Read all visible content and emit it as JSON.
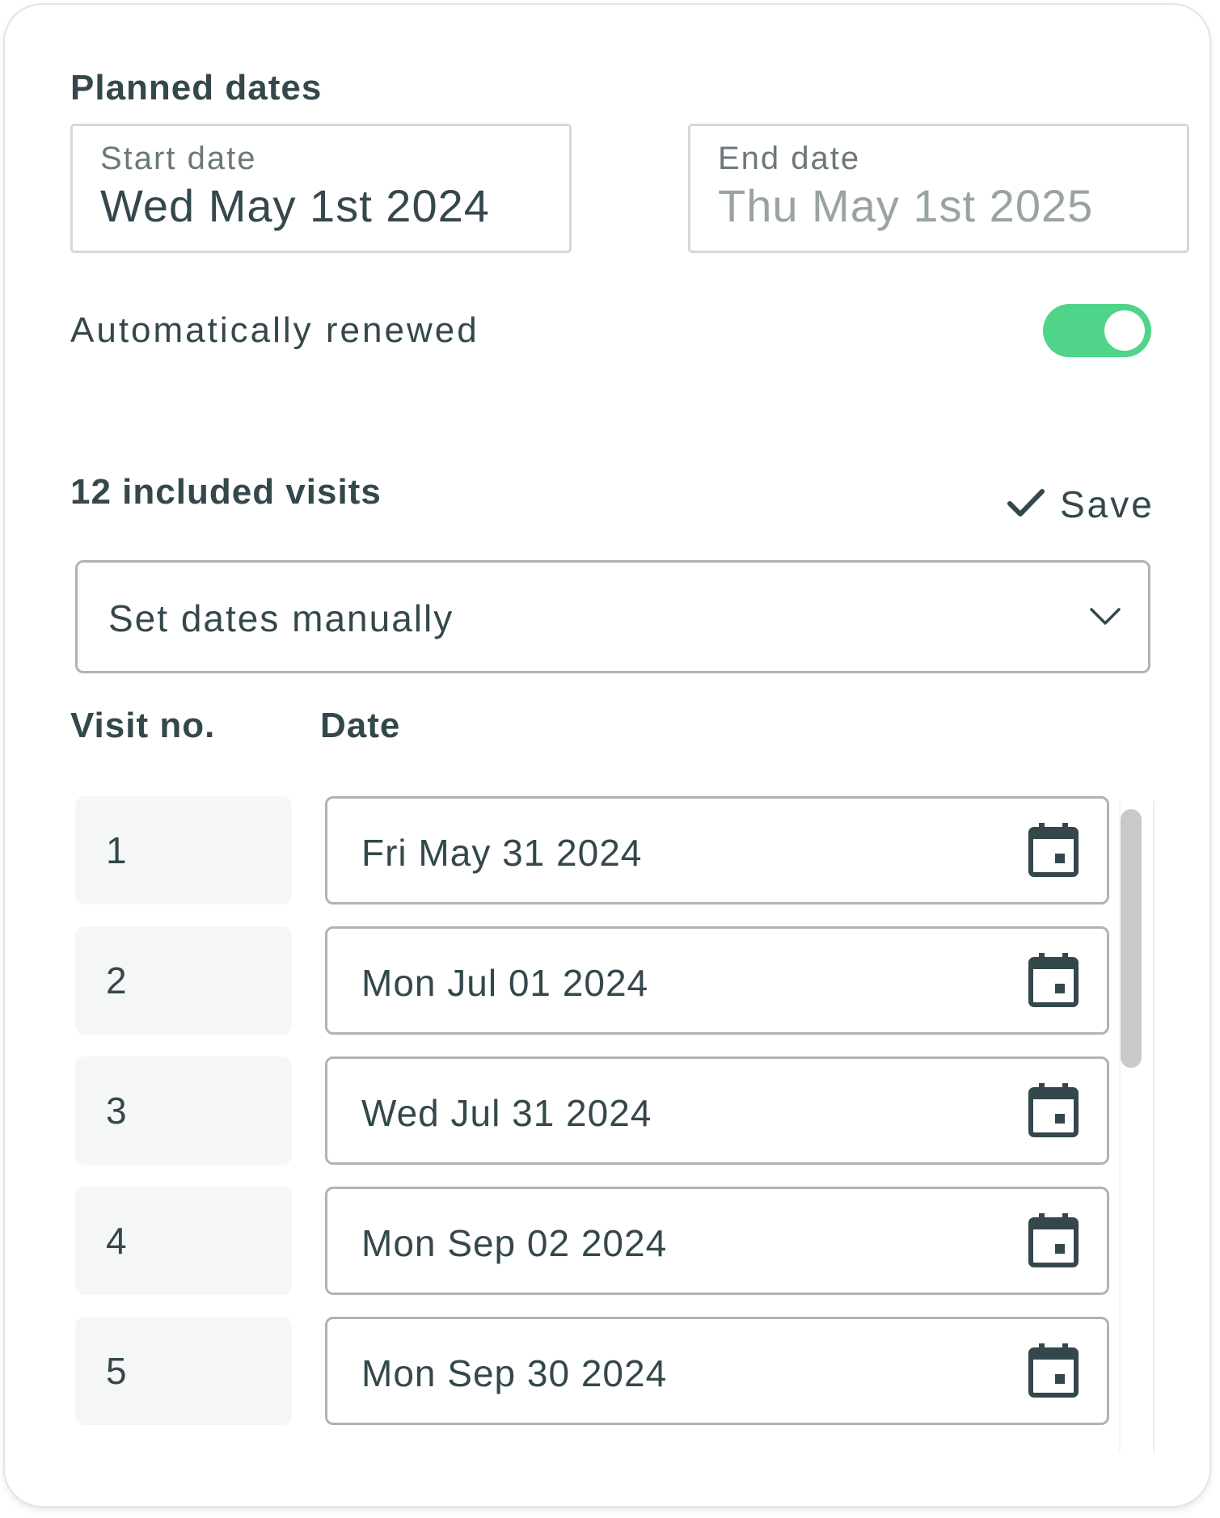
{
  "planned_dates": {
    "title": "Planned dates",
    "start": {
      "label": "Start date",
      "value": "Wed May 1st 2024"
    },
    "end": {
      "label": "End date",
      "value": "Thu May 1st 2025"
    },
    "auto_renew": {
      "label": "Automatically renewed",
      "enabled": true
    }
  },
  "visits": {
    "title": "12 included visits",
    "save_label": "Save",
    "mode_select": {
      "value": "Set dates manually",
      "icon": "chevron-down-icon"
    },
    "columns": {
      "number": "Visit no.",
      "date": "Date"
    },
    "rows": [
      {
        "number": "1",
        "date": "Fri May 31 2024"
      },
      {
        "number": "2",
        "date": "Mon Jul 01 2024"
      },
      {
        "number": "3",
        "date": "Wed Jul 31 2024"
      },
      {
        "number": "4",
        "date": "Mon Sep 02 2024"
      },
      {
        "number": "5",
        "date": "Mon Sep 30 2024"
      }
    ]
  },
  "colors": {
    "text": "#34484c",
    "toggle_on": "#4fd48a",
    "muted": "#9aa3a4"
  }
}
